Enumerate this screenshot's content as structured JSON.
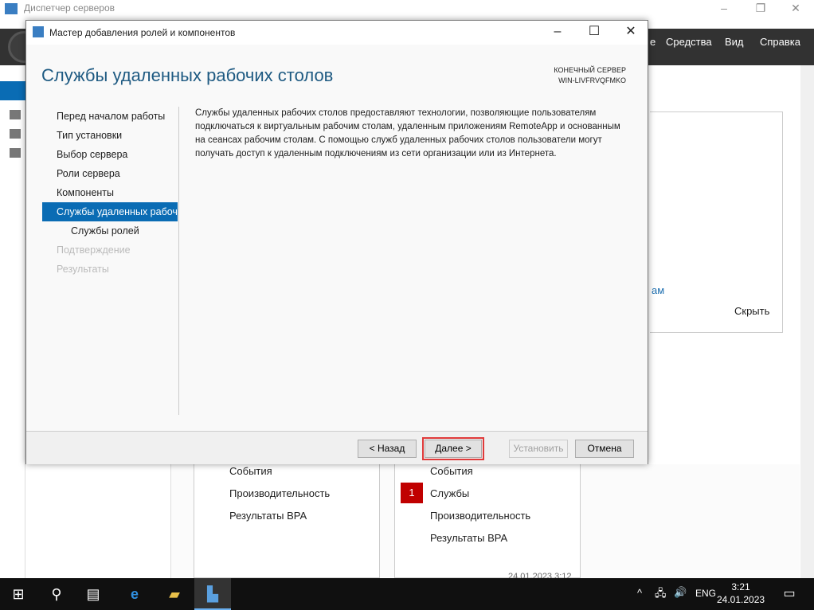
{
  "app": {
    "title": "Диспетчер серверов",
    "menu": [
      "е",
      "Средства",
      "Вид",
      "Справка"
    ],
    "panel_partial": "ам",
    "hide_link": "Скрыть"
  },
  "tiles": [
    {
      "items": [
        "События",
        "Производительность",
        "Результаты BPA"
      ]
    },
    {
      "badge": "1",
      "items": [
        "События",
        "Службы",
        "Производительность",
        "Результаты BPA"
      ],
      "timestamp": "24.01.2023 3:12"
    }
  ],
  "dialog": {
    "title": "Мастер добавления ролей и компонентов",
    "heading": "Службы удаленных рабочих столов",
    "server_label": "КОНЕЧНЫЙ СЕРВЕР",
    "server_name": "WIN-LIVFRVQFMKO",
    "steps": [
      {
        "label": "Перед началом работы"
      },
      {
        "label": "Тип установки"
      },
      {
        "label": "Выбор сервера"
      },
      {
        "label": "Роли сервера"
      },
      {
        "label": "Компоненты"
      },
      {
        "label": "Службы удаленных рабочих столов"
      },
      {
        "label": "Службы ролей"
      },
      {
        "label": "Подтверждение"
      },
      {
        "label": "Результаты"
      }
    ],
    "description": "Службы удаленных рабочих столов предоставляют технологии, позволяющие пользователям подключаться к виртуальным рабочим столам, удаленным приложениям RemoteApp и основанным на сеансах рабочим столам. С помощью служб удаленных рабочих столов пользователи могут получать доступ к удаленным подключениям из сети организации или из Интернета.",
    "buttons": {
      "back": "< Назад",
      "next": "Далее >",
      "install": "Установить",
      "cancel": "Отмена"
    }
  },
  "taskbar": {
    "lang": "ENG",
    "time": "3:21",
    "date": "24.01.2023"
  }
}
